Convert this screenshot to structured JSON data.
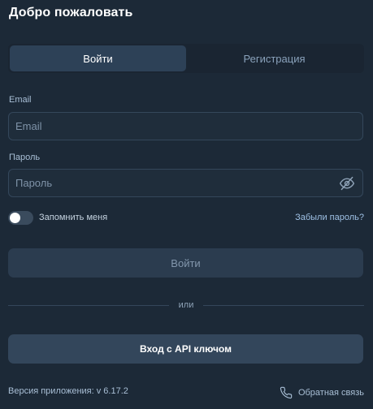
{
  "header": {
    "title": "Добро пожаловать"
  },
  "tabs": [
    {
      "label": "Войти",
      "active": true
    },
    {
      "label": "Регистрация",
      "active": false
    }
  ],
  "form": {
    "email": {
      "label": "Email",
      "placeholder": "Email",
      "value": ""
    },
    "password": {
      "label": "Пароль",
      "placeholder": "Пароль",
      "value": "",
      "toggle_icon": "eye-off-icon"
    },
    "remember": {
      "label": "Запомнить меня",
      "checked": false
    },
    "forgot_label": "Забыли пароль?",
    "submit_label": "Войти",
    "divider_label": "или",
    "api_key_label": "Вход с API ключом"
  },
  "footer": {
    "version_label": "Версия приложения: v 6.17.2",
    "feedback_label": "Обратная связь",
    "feedback_icon": "phone-icon"
  },
  "colors": {
    "background": "#1c2937",
    "tab_active": "#2d4157",
    "link": "#9ec0e4",
    "button_disabled": "#2b3c4f",
    "button_secondary": "#33465b"
  }
}
